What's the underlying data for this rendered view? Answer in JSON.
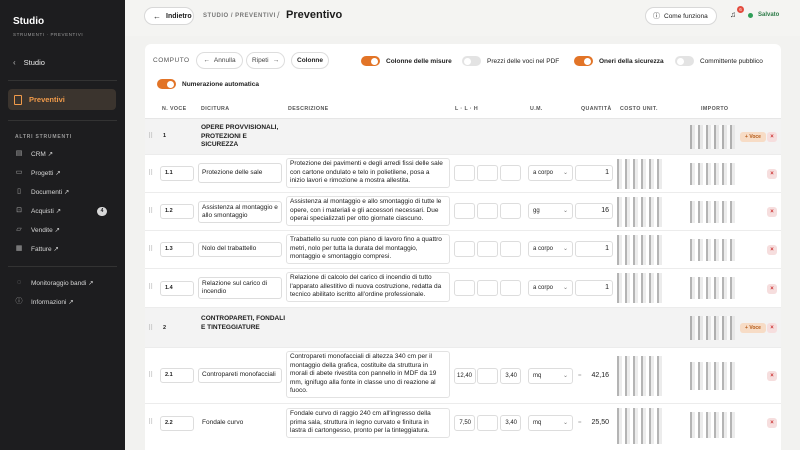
{
  "sidebar": {
    "title": "Studio",
    "subtitle": "STRUMENTI · PREVENTIVI",
    "studio_label": "Studio",
    "active_label": "Preventivi",
    "section_label": "ALTRI STRUMENTI",
    "items": [
      {
        "label": "CRM ↗",
        "icon": "crm-icon"
      },
      {
        "label": "Progetti ↗",
        "icon": "folder-icon"
      },
      {
        "label": "Documenti ↗",
        "icon": "document-icon"
      },
      {
        "label": "Acquisti ↗",
        "icon": "cart-icon",
        "badge": "4"
      },
      {
        "label": "Vendite ↗",
        "icon": "truck-icon"
      },
      {
        "label": "Fatture ↗",
        "icon": "invoice-icon"
      }
    ],
    "extra_items": [
      {
        "label": "Monitoraggio bandi ↗",
        "icon": "monitor-icon"
      },
      {
        "label": "Informazioni ↗",
        "icon": "info-icon"
      }
    ]
  },
  "topbar": {
    "back_label": "Indietro",
    "breadcrumb": "STUDIO / PREVENTIVI",
    "separator": "/",
    "title": "Preventivo",
    "help_label": "Come funziona",
    "notifications_count": "6",
    "saved_label": "Salvato"
  },
  "toolbar": {
    "computo_label": "COMPUTO",
    "undo_label": "Annulla",
    "redo_label": "Ripeti",
    "columns_label": "Colonne",
    "toggles": [
      {
        "label": "Colonne delle misure",
        "on": true
      },
      {
        "label": "Prezzi delle voci nel PDF",
        "on": false
      },
      {
        "label": "Oneri della sicurezza",
        "on": true
      },
      {
        "label": "Committente pubblico",
        "on": false
      },
      {
        "label": "Numerazione automatica",
        "on": true
      }
    ]
  },
  "table": {
    "headers": {
      "num": "N. VOCE",
      "dicitura": "DICITURA",
      "descrizione": "DESCRIZIONE",
      "dims": "L · L · H",
      "um": "U.M.",
      "qty": "QUANTITÀ",
      "cost": "COSTO UNIT.",
      "amount": "IMPORTO"
    },
    "add_voce_label": "+ Voce",
    "delete_label": "×",
    "rows": [
      {
        "type": "cat",
        "num": "1",
        "dicitura": "OPERE PROVVISIONALI, PROTEZIONI E SICUREZZA"
      },
      {
        "type": "item",
        "num": "1.1",
        "dicitura": "Protezione delle sale",
        "descrizione": "Protezione dei pavimenti e degli arredi fissi delle sale con cartone ondulato e telo in polietilene, posa a inizio lavori e rimozione a mostra allestita.",
        "l": "",
        "w": "",
        "h": "",
        "um": "a corpo",
        "qty": "1"
      },
      {
        "type": "item",
        "num": "1.2",
        "dicitura": "Assistenza al montaggio e allo smontaggio",
        "descrizione": "Assistenza al montaggio e allo smontaggio di tutte le opere, con i materiali e gli accessori necessari. Due operai specializzati per otto giornate ciascuno.",
        "l": "",
        "w": "",
        "h": "",
        "um": "gg",
        "qty": "16"
      },
      {
        "type": "item",
        "num": "1.3",
        "dicitura": "Nolo del trabattello",
        "descrizione": "Trabattello su ruote con piano di lavoro fino a quattro metri, nolo per tutta la durata del montaggio, montaggio e smontaggio compresi.",
        "l": "",
        "w": "",
        "h": "",
        "um": "a corpo",
        "qty": "1"
      },
      {
        "type": "item",
        "num": "1.4",
        "dicitura": "Relazione sul carico di incendio",
        "descrizione": "Relazione di calcolo del carico di incendio di tutto l'apparato allestitivo di nuova costruzione, redatta da tecnico abilitato iscritto all'ordine professionale.",
        "l": "",
        "w": "",
        "h": "",
        "um": "a corpo",
        "qty": "1"
      },
      {
        "type": "cat",
        "num": "2",
        "dicitura": "CONTROPARETI, FONDALI E TINTEGGIATURE"
      },
      {
        "type": "item",
        "num": "2.1",
        "dicitura": "Contropareti monofacciali",
        "descrizione": "Contropareti monofacciali di altezza 340 cm per il montaggio della grafica, costituite da struttura in morali di abete rivestita con pannello in MDF da 19 mm, ignifugo alla fonte in classe uno di reazione al fuoco.",
        "l": "12,40",
        "w": "",
        "h": "3,40",
        "um": "mq",
        "qty": "42,16",
        "calc": true
      },
      {
        "type": "item",
        "num": "2.2",
        "dicitura": "Fondale curvo",
        "descrizione": "Fondale curvo di raggio 240 cm all'ingresso della prima sala, struttura in legno curvato e finitura in lastra di cartongesso, pronto per la tinteggiatura.",
        "l": "7,50",
        "w": "",
        "h": "3,40",
        "um": "mq",
        "qty": "25,50",
        "calc": true
      }
    ]
  },
  "colors": {
    "accent": "#e27427",
    "sidebar_bg": "#1d1d1f",
    "saved": "#2f7d4a"
  }
}
